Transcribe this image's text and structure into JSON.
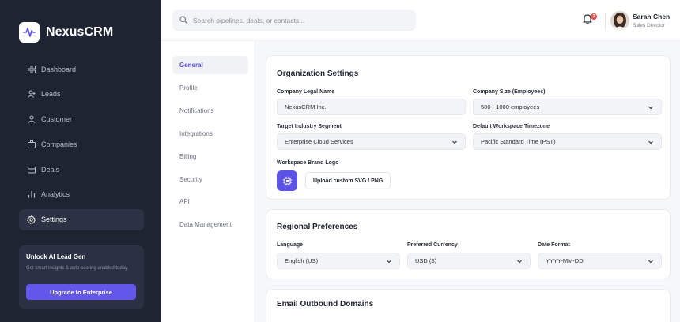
{
  "brand": {
    "name": "NexusCRM"
  },
  "sidebar": {
    "items": [
      {
        "label": "Dashboard",
        "icon": "grid-icon"
      },
      {
        "label": "Leads",
        "icon": "user-plus-icon"
      },
      {
        "label": "Customer",
        "icon": "user-icon"
      },
      {
        "label": "Companies",
        "icon": "briefcase-icon"
      },
      {
        "label": "Deals",
        "icon": "wallet-icon"
      },
      {
        "label": "Analytics",
        "icon": "bar-chart-icon"
      },
      {
        "label": "Settings",
        "icon": "gear-icon",
        "active": true
      }
    ],
    "promo": {
      "title": "Unlock AI Lead Gen",
      "description": "Get smart insights & auto-scoring enabled today.",
      "button": "Upgrade to Enterprise"
    }
  },
  "topbar": {
    "search_placeholder": "Search pipelines, deals, or contacts...",
    "notification_count": "2",
    "user": {
      "name": "Sarah Chen",
      "role": "Sales Director"
    }
  },
  "settings_nav": {
    "items": [
      "General",
      "Profile",
      "Notifications",
      "Integrations",
      "Billing",
      "Security",
      "API",
      "Data Management"
    ],
    "active": "General"
  },
  "org_settings": {
    "title": "Organization Settings",
    "legal_name": {
      "label": "Company Legal Name",
      "value": "NexusCRM Inc."
    },
    "company_size": {
      "label": "Company Size (Employees)",
      "value": "500 - 1000 employees"
    },
    "industry": {
      "label": "Target Industry Segment",
      "value": "Enterprise Cloud Services"
    },
    "timezone": {
      "label": "Default Workspace Timezone",
      "value": "Pacific Standard Time (PST)"
    },
    "logo": {
      "label": "Workspace Brand Logo",
      "button": "Upload custom SVG / PNG"
    }
  },
  "regional": {
    "title": "Regional Preferences",
    "language": {
      "label": "Language",
      "value": "English (US)"
    },
    "currency": {
      "label": "Preferred Currency",
      "value": "USD ($)"
    },
    "date_format": {
      "label": "Date Format",
      "value": "YYYY-MM-DD"
    }
  },
  "email_domains": {
    "title": "Email Outbound Domains"
  },
  "colors": {
    "sidebar_bg": "#1f2433",
    "accent": "#6257ea",
    "badge": "#e8524f"
  }
}
